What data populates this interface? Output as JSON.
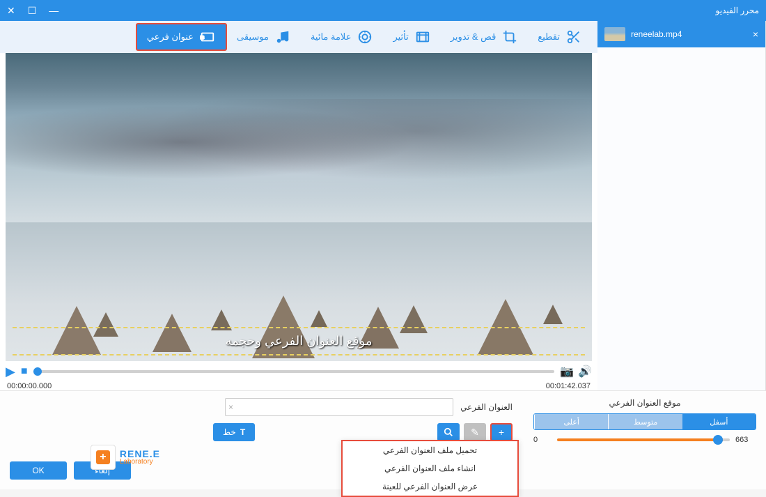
{
  "window": {
    "title": "محرر الفيديو"
  },
  "file": {
    "name": "reneelab.mp4"
  },
  "toolbar": {
    "cut": "تقطيع",
    "crop": "قص & تدوير",
    "effect": "تأثير",
    "watermark": "علامة مائية",
    "music": "موسيقى",
    "subtitle": "عنوان فرعي"
  },
  "preview": {
    "subtitle_overlay": "موقع العنوان الفرعي وحجمه"
  },
  "player": {
    "time_start": "00:00:00.000",
    "time_end": "00:01:42.037"
  },
  "subtitle_panel": {
    "label": "العنوان الفرعي",
    "font_btn": "خط",
    "menu": {
      "load": "تحميل ملف العنوان الفرعي",
      "create": "انشاء ملف العنوان الفرعي",
      "sample": "عرض العنوان الفرعي للعينة"
    }
  },
  "position_panel": {
    "label": "موقع العنوان الفرعي",
    "top": "أعلى",
    "middle": "متوسط",
    "bottom": "أسفل",
    "min": "0",
    "value": "663"
  },
  "footer": {
    "ok": "OK",
    "cancel": "إلغاء"
  },
  "logo": {
    "main": "RENE.E",
    "sub": "Laboratory"
  }
}
